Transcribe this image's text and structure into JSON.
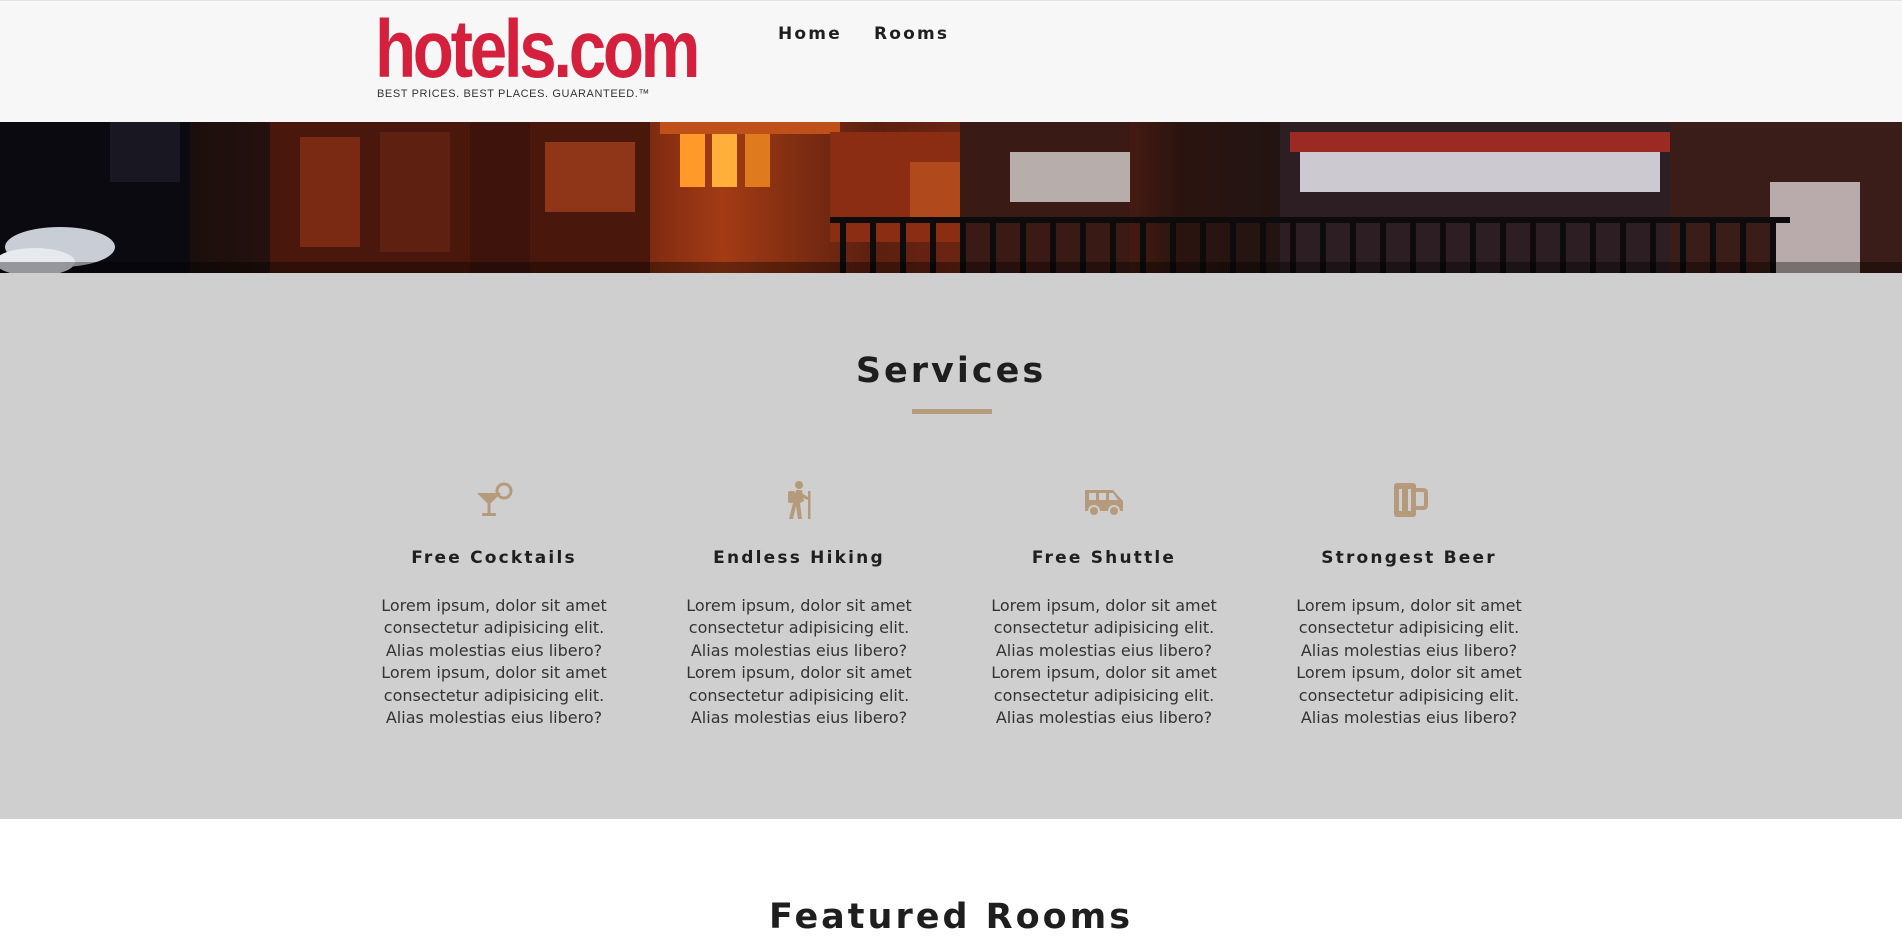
{
  "brand": {
    "logo_text": "hotels.com",
    "tagline": "BEST PRICES. BEST PLACES. GUARANTEED.™",
    "color": "#d41f3d"
  },
  "nav": {
    "items": [
      {
        "label": "Home"
      },
      {
        "label": "Rooms"
      }
    ]
  },
  "banner": {
    "image_name": "hotel-lodge-night-photo"
  },
  "services": {
    "title": "Services",
    "accent_color": "#b59b7b",
    "background_color": "#cfcfcf",
    "items": [
      {
        "icon": "cocktail-icon",
        "title": "Free Cocktails",
        "text": "Lorem ipsum, dolor sit amet consectetur adipisicing elit. Alias molestias eius libero? Lorem ipsum, dolor sit amet consectetur adipisicing elit. Alias molestias eius libero?"
      },
      {
        "icon": "hiking-icon",
        "title": "Endless Hiking",
        "text": "Lorem ipsum, dolor sit amet consectetur adipisicing elit. Alias molestias eius libero? Lorem ipsum, dolor sit amet consectetur adipisicing elit. Alias molestias eius libero?"
      },
      {
        "icon": "shuttle-van-icon",
        "title": "Free Shuttle",
        "text": "Lorem ipsum, dolor sit amet consectetur adipisicing elit. Alias molestias eius libero? Lorem ipsum, dolor sit amet consectetur adipisicing elit. Alias molestias eius libero?"
      },
      {
        "icon": "beer-mug-icon",
        "title": "Strongest Beer",
        "text": "Lorem ipsum, dolor sit amet consectetur adipisicing elit. Alias molestias eius libero? Lorem ipsum, dolor sit amet consectetur adipisicing elit. Alias molestias eius libero?"
      }
    ]
  },
  "featured": {
    "title": "Featured Rooms"
  }
}
